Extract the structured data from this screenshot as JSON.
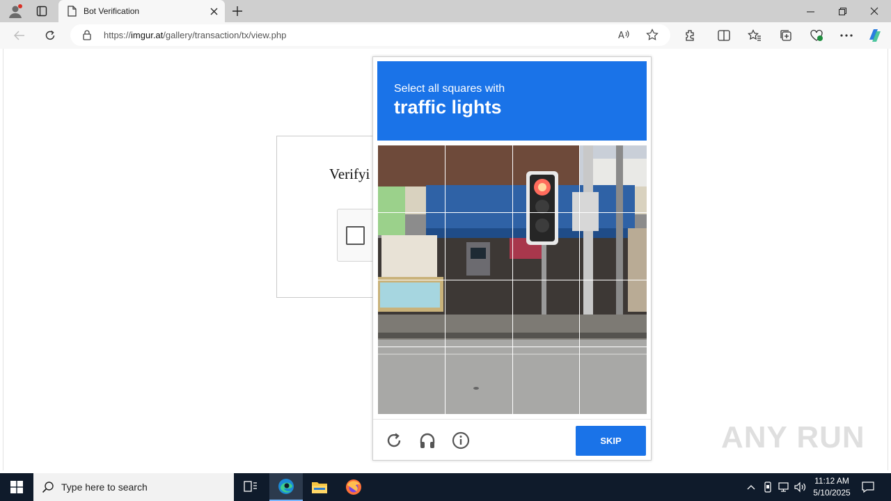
{
  "browser": {
    "tab_title": "Bot Verification",
    "url_prefix": "https://",
    "url_host": "imgur.at",
    "url_path": "/gallery/transaction/tx/view.php"
  },
  "page": {
    "heading": "Verifyi"
  },
  "challenge": {
    "instruction": "Select all squares with",
    "target": "traffic lights",
    "grid_rows": 4,
    "grid_cols": 4,
    "skip_label": "SKIP",
    "header_color": "#1a73e8"
  },
  "watermark": "ANY RUN",
  "taskbar": {
    "search_placeholder": "Type here to search",
    "time": "11:12 AM",
    "date": "5/10/2025"
  }
}
